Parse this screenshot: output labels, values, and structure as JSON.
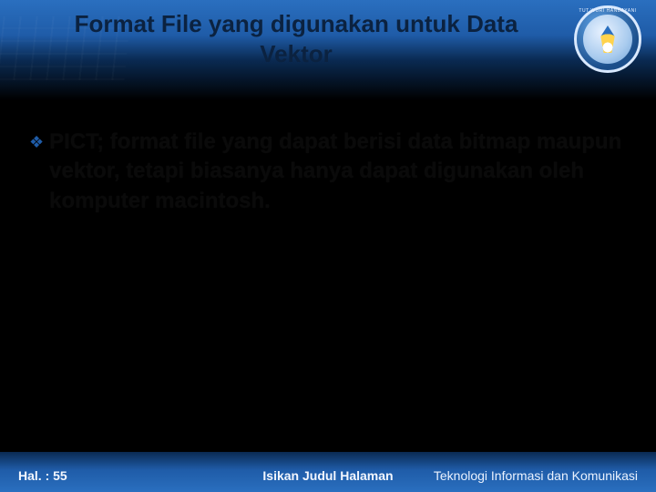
{
  "header": {
    "title": "Format File yang digunakan untuk Data Vektor",
    "logo_caption": "TUT WURI HANDAYANI"
  },
  "content": {
    "bullets": [
      {
        "marker": "❖",
        "text": "PICT; format file yang dapat berisi data bitmap maupun vektor, tetapi biasanya hanya dapat digunakan oleh komputer macintosh."
      }
    ]
  },
  "footer": {
    "page_label": "Hal. : 55",
    "center_placeholder": "Isikan Judul Halaman",
    "right_text": "Teknologi Informasi dan Komunikasi"
  },
  "colors": {
    "accent": "#1f5ca8",
    "band_top": "#2a6fbf",
    "band_deep": "#0a2a52"
  }
}
